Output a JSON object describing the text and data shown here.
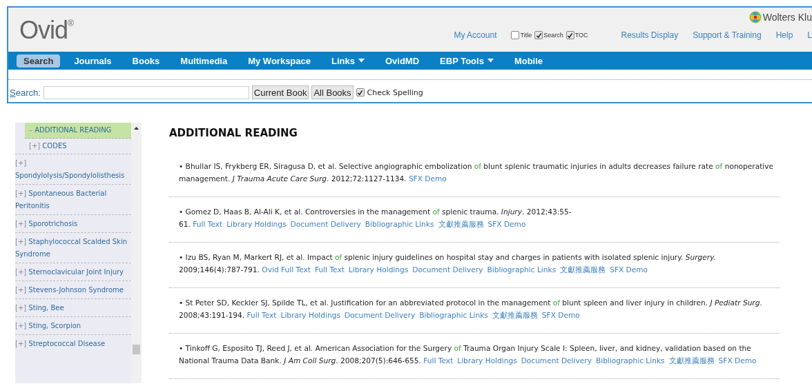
{
  "header": {
    "logo": "Ovid$^{®}$",
    "brand": "Wolters Klu",
    "account_link": "My Account",
    "options": [
      {
        "label": "Title",
        "checked": false
      },
      {
        "label": "Search",
        "checked": true
      },
      {
        "label": "TOC",
        "checked": true
      }
    ],
    "links": [
      "Results Display",
      "Support & Training",
      "Help",
      "L"
    ]
  },
  "nav": [
    {
      "label": "Search",
      "selected": true,
      "has_menu": false
    },
    {
      "label": "Journals",
      "selected": false,
      "has_menu": false
    },
    {
      "label": "Books",
      "selected": false,
      "has_menu": false
    },
    {
      "label": "Multimedia",
      "selected": false,
      "has_menu": false
    },
    {
      "label": "My Workspace",
      "selected": false,
      "has_menu": false
    },
    {
      "label": "Links",
      "selected": false,
      "has_menu": true
    },
    {
      "label": "OvidMD",
      "selected": false,
      "has_menu": false
    },
    {
      "label": "EBP Tools",
      "selected": false,
      "has_menu": true
    },
    {
      "label": "Mobile",
      "selected": false,
      "has_menu": false
    }
  ],
  "search": {
    "label": "Search:",
    "buttons": [
      "Current Book",
      "All Books"
    ],
    "spelling": {
      "label": "Check Spelling",
      "checked": true
    }
  },
  "sidebar": {
    "section_items": [
      {
        "toggle": "–",
        "label": "ADDITIONAL READING",
        "selected": true
      },
      {
        "toggle": "[+]",
        "label": "CODES",
        "selected": false
      }
    ],
    "items": [
      {
        "toggle": "[+]",
        "label": "Spondylolysis/Spondylolisthesis",
        "selected": false
      },
      {
        "toggle": "[+]",
        "label": "Spontaneous Bacterial Peritonitis",
        "selected": false
      },
      {
        "toggle": "[+]",
        "label": "Sporotrichosis",
        "selected": false
      },
      {
        "toggle": "[+]",
        "label": "Staphylococcal Scalded Skin Syndrome",
        "selected": false
      },
      {
        "toggle": "[+]",
        "label": "Sternoclavicular Joint Injury",
        "selected": false
      },
      {
        "toggle": "[+]",
        "label": "Stevens-Johnson Syndrome",
        "selected": false
      },
      {
        "toggle": "[+]",
        "label": "Sting, Bee",
        "selected": false
      },
      {
        "toggle": "[+]",
        "label": "Sting, Scorpion",
        "selected": false
      },
      {
        "toggle": "[+]",
        "label": "Streptococcal Disease",
        "selected": false
      }
    ]
  },
  "content": {
    "heading": "ADDITIONAL READING",
    "references": [
      {
        "parts": [
          {
            "kind": "text",
            "text": "• Bhullar IS, Frykberg ER, Siragusa D, et al. Selective angiographic embolization "
          },
          {
            "kind": "term",
            "text": "of"
          },
          {
            "kind": "text",
            "text": " blunt splenic traumatic injuries in adults decreases failure rate "
          },
          {
            "kind": "term",
            "text": "of"
          },
          {
            "kind": "text",
            "text": " nonoperative management. "
          },
          {
            "kind": "italic",
            "text": "J Trauma Acute Care Surg"
          },
          {
            "kind": "text",
            "text": ". 2012;72:1127-1134."
          }
        ],
        "links": [
          "SFX Demo"
        ]
      },
      {
        "parts": [
          {
            "kind": "text",
            "text": "• Gomez D, Haas B, Al-Ali K, et al. Controversies in the management "
          },
          {
            "kind": "term",
            "text": "of"
          },
          {
            "kind": "text",
            "text": " splenic trauma. "
          },
          {
            "kind": "italic",
            "text": "Injury"
          },
          {
            "kind": "text",
            "text": ". 2012;43:55-61."
          }
        ],
        "links": [
          "Full Text",
          "Library Holdings",
          "Document Delivery",
          "Bibliographic Links",
          "文獻推薦服務",
          "SFX Demo"
        ]
      },
      {
        "parts": [
          {
            "kind": "text",
            "text": "• Izu BS, Ryan M, Markert RJ, et al. Impact "
          },
          {
            "kind": "term",
            "text": "of"
          },
          {
            "kind": "text",
            "text": " splenic injury guidelines on hospital stay and charges in patients with isolated splenic injury. "
          },
          {
            "kind": "italic",
            "text": "Surgery."
          },
          {
            "kind": "text",
            "text": " 2009;146(4):787-791."
          }
        ],
        "links": [
          "Ovid Full Text",
          "Full Text",
          "Library Holdings",
          "Document Delivery",
          "Bibliographic Links",
          "文獻推薦服務",
          "SFX Demo"
        ]
      },
      {
        "parts": [
          {
            "kind": "text",
            "text": "• St Peter SD, Keckler SJ, Spilde TL, et al. Justification for an abbreviated protocol in the management "
          },
          {
            "kind": "term",
            "text": "of"
          },
          {
            "kind": "text",
            "text": " blunt spleen and liver injury in children. "
          },
          {
            "kind": "italic",
            "text": "J Pediatr Surg"
          },
          {
            "kind": "text",
            "text": ". 2008;43:191-194."
          }
        ],
        "links": [
          "Full Text",
          "Library Holdings",
          "Document Delivery",
          "Bibliographic Links",
          "文獻推薦服務",
          "SFX Demo"
        ]
      },
      {
        "parts": [
          {
            "kind": "text",
            "text": "• Tinkoff G, Esposito TJ, Reed J, et al. American Association for the Surgery "
          },
          {
            "kind": "term",
            "text": "of"
          },
          {
            "kind": "text",
            "text": " Trauma Organ Injury Scale I: Spleen, liver, and kidney, validation based on the National Trauma Data Bank. "
          },
          {
            "kind": "italic",
            "text": "J Am Coll Surg"
          },
          {
            "kind": "text",
            "text": ". 2008;207(5):646-655."
          }
        ],
        "links": [
          "Full Text",
          "Library Holdings",
          "Document Delivery",
          "Bibliographic Links",
          "文獻推薦服務",
          "SFX Demo"
        ]
      }
    ]
  }
}
